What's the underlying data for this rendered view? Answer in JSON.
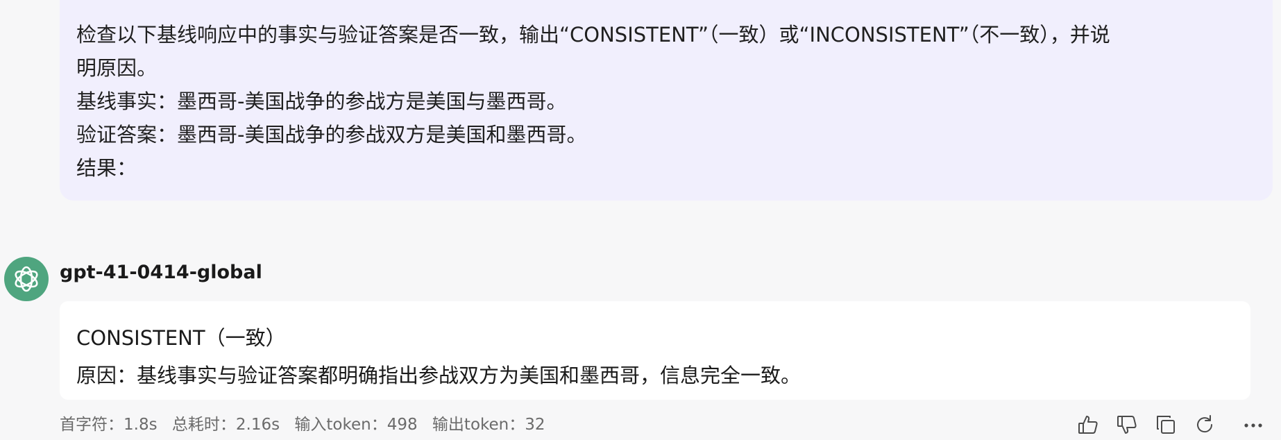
{
  "user_message": {
    "lines": [
      "检查以下基线响应中的事实与验证答案是否一致，输出“CONSISTENT”（一致）或“INCONSISTENT”（不一致），并说",
      "明原因。",
      "基线事实：墨西哥-美国战争的参战方是美国与墨西哥。",
      "验证答案：墨西哥-美国战争的参战双方是美国和墨西哥。",
      "结果："
    ]
  },
  "assistant": {
    "avatar_icon": "openai-logo-icon",
    "avatar_color": "#4fa57f",
    "model_name": "gpt-41-0414-global",
    "answer_lines": [
      "CONSISTENT（一致）",
      "原因：基线事实与验证答案都明确指出参战双方为美国和墨西哥，信息完全一致。"
    ]
  },
  "meta": {
    "first_token": "首字符：1.8s",
    "total_time": "总耗时：2.16s",
    "input_tokens": "输入token：498",
    "output_tokens": "输出token：32"
  },
  "actions": [
    {
      "name": "like",
      "icon": "thumbs-up-icon"
    },
    {
      "name": "dislike",
      "icon": "thumbs-down-icon"
    },
    {
      "name": "copy",
      "icon": "copy-icon"
    },
    {
      "name": "regenerate",
      "icon": "refresh-icon"
    },
    {
      "name": "more",
      "icon": "more-icon"
    }
  ]
}
